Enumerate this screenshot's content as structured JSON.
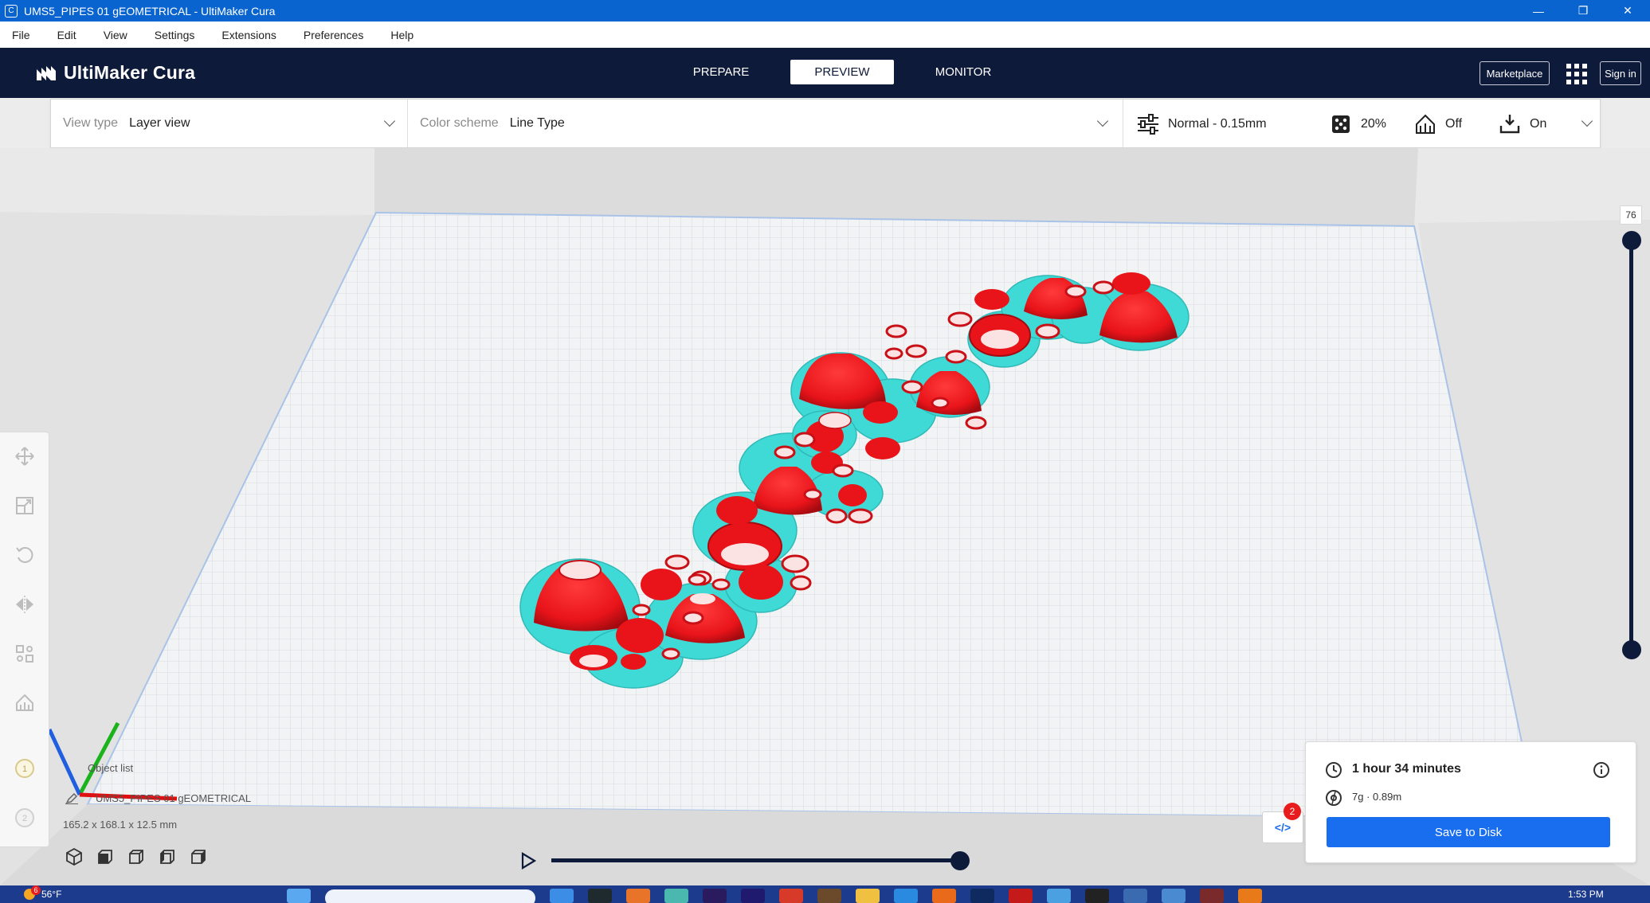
{
  "window": {
    "title": "UMS5_PIPES 01 gEOMETRICAL - UltiMaker Cura",
    "controls": [
      "—",
      "❐",
      "✕"
    ]
  },
  "menu": [
    "File",
    "Edit",
    "View",
    "Settings",
    "Extensions",
    "Preferences",
    "Help"
  ],
  "header": {
    "logo_text": "UltiMaker Cura",
    "tabs": [
      {
        "label": "PREPARE",
        "active": false
      },
      {
        "label": "PREVIEW",
        "active": true
      },
      {
        "label": "MONITOR",
        "active": false
      }
    ],
    "marketplace_label": "Marketplace",
    "signin_label": "Sign in"
  },
  "toolbar": {
    "view_type_label": "View type",
    "view_type_value": "Layer view",
    "color_scheme_label": "Color scheme",
    "color_scheme_value": "Line Type",
    "profile": "Normal - 0.15mm",
    "infill": "20%",
    "support": "Off",
    "adhesion": "On"
  },
  "left_tools": [
    "move-icon",
    "scale-icon",
    "rotate-icon",
    "mirror-icon",
    "per-model-settings-icon",
    "support-blocker-icon",
    "extruder-1-icon",
    "extruder-2-icon"
  ],
  "layer_slider": {
    "current": "76"
  },
  "object_list": {
    "label": "Object list",
    "object_name": "UMS5_PIPES 01 gEOMETRICAL",
    "dimensions": "165.2 x 168.1 x 12.5 mm"
  },
  "output": {
    "print_time": "1 hour 34 minutes",
    "material": "7g · 0.89m",
    "save_label": "Save to Disk",
    "code_badge": "2"
  },
  "taskbar": {
    "weather": "56°F",
    "weather_badge": "6",
    "time": "1:53 PM"
  },
  "colors": {
    "header": "#0e1a3a",
    "accent": "#196ef0",
    "model": "#e8141a",
    "skirt": "#3fd9d6",
    "titlebar": "#0a64d0"
  }
}
